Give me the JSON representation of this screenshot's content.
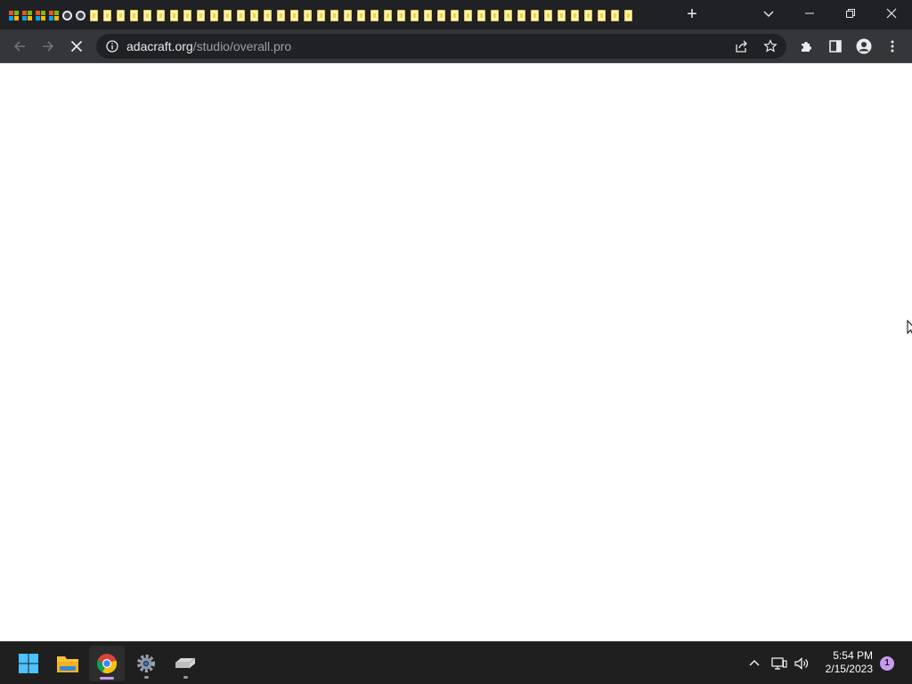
{
  "browser": {
    "tab_favicons": [
      "ms",
      "ms",
      "ms",
      "ms",
      "globe",
      "globe",
      "doc",
      "doc",
      "doc",
      "doc",
      "doc",
      "doc",
      "doc",
      "doc",
      "doc",
      "doc",
      "doc",
      "doc",
      "doc",
      "doc",
      "doc",
      "doc",
      "doc",
      "doc",
      "doc",
      "doc",
      "doc",
      "doc",
      "doc",
      "doc",
      "doc",
      "doc",
      "doc",
      "doc",
      "doc",
      "doc",
      "doc",
      "doc",
      "doc",
      "doc",
      "doc",
      "doc",
      "doc",
      "doc",
      "doc",
      "doc",
      "doc"
    ],
    "new_tab_label": "+",
    "address": {
      "host": "adacraft.org",
      "path": "/studio/overall.pro"
    },
    "loading": true
  },
  "taskbar": {
    "apps": [
      "start",
      "file-explorer",
      "chrome",
      "settings",
      "drive"
    ],
    "active_app": "chrome",
    "clock": {
      "time": "5:54 PM",
      "date": "2/15/2023"
    },
    "notification_count": "1"
  },
  "colors": {
    "titlebar": "#202124",
    "toolbar": "#35363a",
    "omnibox": "#202124",
    "taskbar": "#1f1f1f",
    "accent": "#c89bf0"
  }
}
